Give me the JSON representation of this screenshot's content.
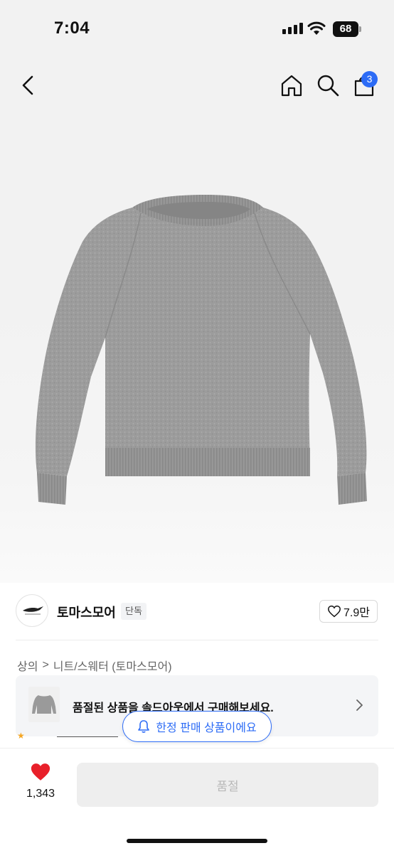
{
  "status_bar": {
    "time": "7:04",
    "battery": "68"
  },
  "nav": {
    "cart_count": "3"
  },
  "brand": {
    "name": "토마스모어",
    "tag": "단독",
    "likes": "7.9만"
  },
  "breadcrumb": {
    "level1": "상의",
    "separator": ">",
    "level2": "니트/스웨터 (토마스모어)"
  },
  "soldout_card": {
    "text": "품절된 상품을 솔드아웃에서 구매해보세요."
  },
  "toast": {
    "text": "한정 판매 상품이에요"
  },
  "bottom_bar": {
    "like_count": "1,343",
    "buy_label": "품절"
  },
  "colors": {
    "accent": "#2d6cf6",
    "heart": "#e8202a",
    "disabled_bg": "#eeeeee",
    "disabled_text": "#b8b8b8"
  },
  "icons": [
    "back-icon",
    "home-icon",
    "search-icon",
    "cart-icon",
    "heart-outline-icon",
    "chevron-right-icon",
    "bell-icon",
    "heart-filled-icon"
  ]
}
